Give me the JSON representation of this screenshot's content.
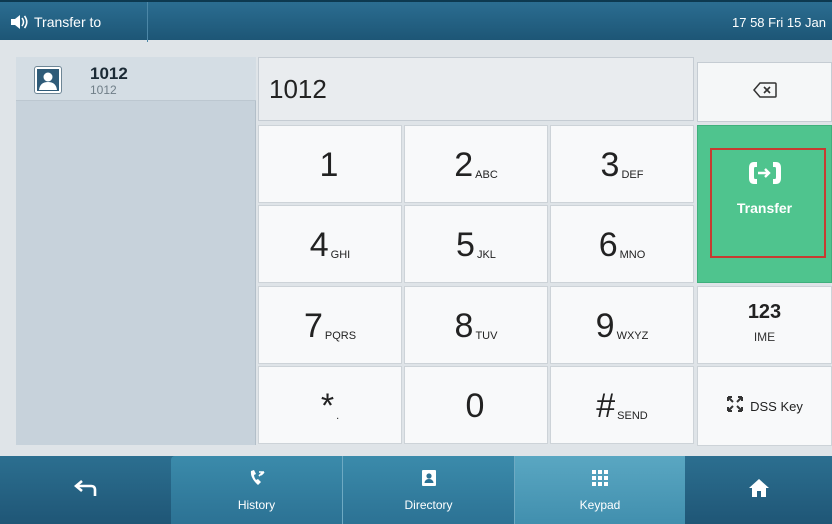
{
  "statusbar": {
    "title": "Transfer to",
    "datetime": "17 58 Fri 15 Jan"
  },
  "contact": {
    "name": "1012",
    "number": "1012"
  },
  "dial": {
    "value": "1012"
  },
  "keypad": [
    {
      "digit": "1",
      "letters": ""
    },
    {
      "digit": "2",
      "letters": "ABC"
    },
    {
      "digit": "3",
      "letters": "DEF"
    },
    {
      "digit": "4",
      "letters": "GHI"
    },
    {
      "digit": "5",
      "letters": "JKL"
    },
    {
      "digit": "6",
      "letters": "MNO"
    },
    {
      "digit": "7",
      "letters": "PQRS"
    },
    {
      "digit": "8",
      "letters": "TUV"
    },
    {
      "digit": "9",
      "letters": "WXYZ"
    },
    {
      "digit": "*",
      "letters": "."
    },
    {
      "digit": "0",
      "letters": ""
    },
    {
      "digit": "#",
      "letters": "SEND"
    }
  ],
  "softkeys": {
    "transfer_label": "Transfer",
    "ime_mode": "123",
    "ime_label": "IME",
    "dss_label": "DSS Key"
  },
  "bottom_nav": {
    "history": "History",
    "directory": "Directory",
    "keypad": "Keypad"
  },
  "colors": {
    "accent": "#4fc48e",
    "statusbar": "#1d5676",
    "highlight_frame": "#c73b31"
  },
  "icons": {
    "speaker": "speaker-icon",
    "contact": "contact-icon",
    "backspace": "backspace-icon",
    "transfer": "transfer-icon",
    "dss": "expand-icon",
    "back": "back-arrow-icon",
    "history": "history-icon",
    "directory": "directory-icon",
    "keypad": "keypad-grid-icon",
    "home": "home-icon"
  }
}
